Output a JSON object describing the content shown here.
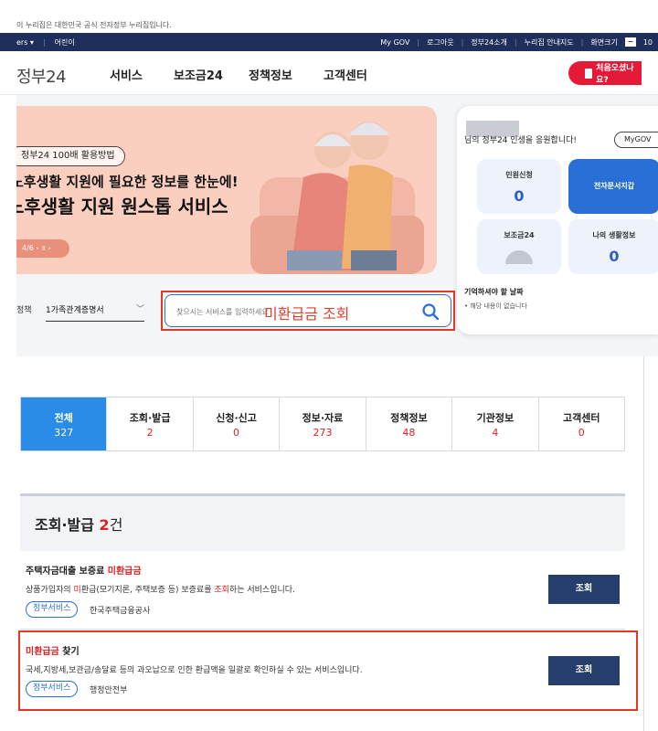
{
  "notice": "이 누리집은 대한민국 공식 전자정부 누리집입니다.",
  "topbar": {
    "language": "ers ▾",
    "kids": "어린이",
    "links": [
      "My GOV",
      "로그아웃",
      "정부24소개",
      "누리집 안내지도",
      "화면크기"
    ],
    "size_value": "−",
    "size_pct": "10"
  },
  "gnb": {
    "logo": "정부24",
    "menu": [
      "서비스",
      "보조금24",
      "정책정보",
      "고객센터"
    ],
    "first_visit": "처음오셨나요?"
  },
  "banner": {
    "chip": "정부24 100배 활용방법",
    "subtitle": "노후생활 지원에 필요한 정보를 한눈에!",
    "title": "노후생활 지원 원스톱 서비스",
    "pager": "4/6 ‹ ॥ ›"
  },
  "side": {
    "greeting": "님의 정부24 인생을 응원합니다!",
    "mygov": "MyGOV",
    "tiles": [
      {
        "label": "민원신청",
        "count": "0"
      },
      {
        "label": "전자문서지갑",
        "count": ""
      },
      {
        "label": "보조금24",
        "count": ""
      },
      {
        "label": "나의 생활정보",
        "count": "0"
      }
    ],
    "remember_title": "기억하셔야 할 날짜",
    "remember_text": "• 해당 내용이 없습니다"
  },
  "search": {
    "label": "정책",
    "select_value": "1가족관계증명서",
    "placeholder": "찾으시는 서비스를 입력하세요",
    "value": "미환급금 조회"
  },
  "tabs": [
    {
      "label": "전체",
      "count": "327"
    },
    {
      "label": "조회·발급",
      "count": "2"
    },
    {
      "label": "신청·신고",
      "count": "0"
    },
    {
      "label": "정보·자료",
      "count": "273"
    },
    {
      "label": "정책정보",
      "count": "48"
    },
    {
      "label": "기관정보",
      "count": "4"
    },
    {
      "label": "고객센터",
      "count": "0"
    }
  ],
  "section": {
    "title": "조회·발급",
    "count": "2",
    "unit": "건"
  },
  "results": [
    {
      "title_pre": "주택자금대출 보증료 ",
      "title_hl": "미환급금",
      "title_post": "",
      "desc_pre": "상품가입자의 ",
      "desc_hl1": "미",
      "desc_mid": "환급(모기지론, 주택보증 등) 보증료를 ",
      "desc_hl2": "조회",
      "desc_post": "하는 서비스입니다.",
      "tag": "정부서비스",
      "org": "한국주택금융공사",
      "button": "조회"
    },
    {
      "title_pre": "",
      "title_hl": "미환급금",
      "title_post": " 찾기",
      "desc": "국세,지방세,보관금/송달료 등의 과오납으로 인한 환급액을 일괄로 확인하실 수 있는 서비스입니다.",
      "tag": "정부서비스",
      "org": "행정안전부",
      "button": "조회"
    }
  ]
}
